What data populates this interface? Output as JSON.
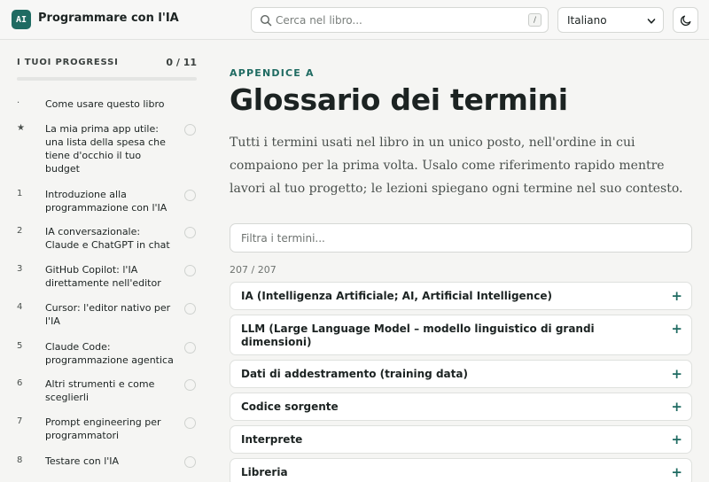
{
  "header": {
    "logo_text": "AI",
    "title": "Programmare con l'IA",
    "search_placeholder": "Cerca nel libro...",
    "search_shortcut": "/",
    "language": "Italiano",
    "theme_icon": "moon-icon"
  },
  "sidebar": {
    "progress_title": "I TUOI PROGRESSI",
    "progress_count": "0 / 11",
    "progress_fraction": 0,
    "items": [
      {
        "num": "·",
        "label": "Come usare questo libro",
        "has_check": false
      },
      {
        "num": "★",
        "label": "La mia prima app utile: una lista della spesa che tiene d'occhio il tuo budget",
        "has_check": true
      },
      {
        "num": "1",
        "label": "Introduzione alla programmazione con l'IA",
        "has_check": true
      },
      {
        "num": "2",
        "label": "IA conversazionale: Claude e ChatGPT in chat",
        "has_check": true
      },
      {
        "num": "3",
        "label": "GitHub Copilot: l'IA direttamente nell'editor",
        "has_check": true
      },
      {
        "num": "4",
        "label": "Cursor: l'editor nativo per l'IA",
        "has_check": true
      },
      {
        "num": "5",
        "label": "Claude Code: programmazione agentica",
        "has_check": true
      },
      {
        "num": "6",
        "label": "Altri strumenti e come sceglierli",
        "has_check": true
      },
      {
        "num": "7",
        "label": "Prompt engineering per programmatori",
        "has_check": true
      },
      {
        "num": "8",
        "label": "Testare con l'IA",
        "has_check": true
      }
    ]
  },
  "main": {
    "eyebrow": "APPENDICE A",
    "title": "Glossario dei termini",
    "intro": "Tutti i termini usati nel libro in un unico posto, nell'ordine in cui compaiono per la prima volta. Usalo come riferimento rapido mentre lavori al tuo progetto; le lezioni spiegano ogni termine nel suo contesto.",
    "filter_placeholder": "Filtra i termini...",
    "count": "207 / 207",
    "expand_symbol": "+",
    "terms": [
      "IA (Intelligenza Artificiale; AI, Artificial Intelligence)",
      "LLM (Large Language Model – modello linguistico di grandi dimensioni)",
      "Dati di addestramento (training data)",
      "Codice sorgente",
      "Interprete",
      "Libreria"
    ]
  },
  "colors": {
    "accent": "#1f6b62",
    "background": "#f5f5f3"
  }
}
